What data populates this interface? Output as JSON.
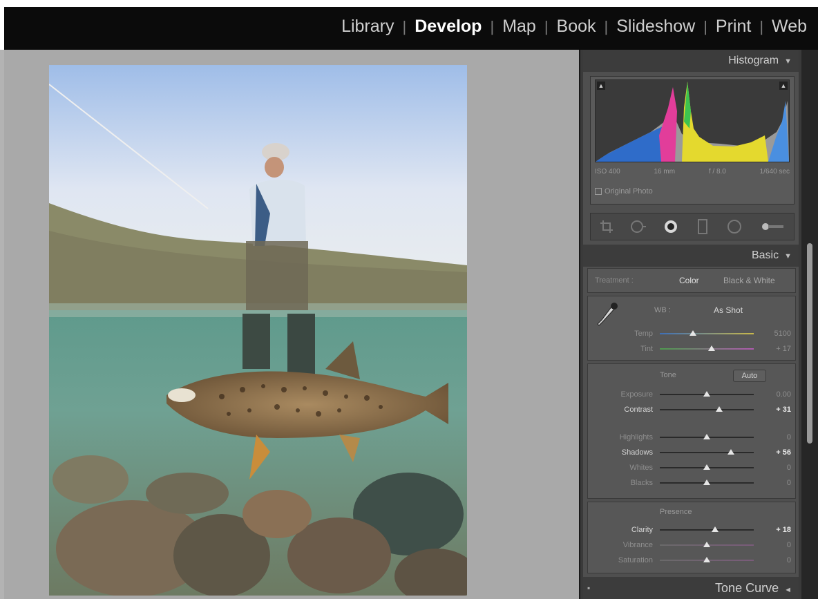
{
  "modules": [
    "Library",
    "Develop",
    "Map",
    "Book",
    "Slideshow",
    "Print",
    "Web"
  ],
  "active_module": "Develop",
  "histogram": {
    "title": "Histogram",
    "info": [
      "ISO 400",
      "16 mm",
      "f / 8.0",
      "1/640 sec"
    ],
    "original_photo": "Original Photo"
  },
  "tools": [
    "crop-overlay-icon",
    "spot-removal-icon",
    "red-eye-icon",
    "graduated-filter-icon",
    "radial-filter-icon",
    "adjustment-brush-icon"
  ],
  "basic": {
    "title": "Basic",
    "treatment_label": "Treatment :",
    "color": "Color",
    "bw": "Black & White",
    "wb_label": "WB :",
    "wb_value": "As Shot",
    "temp": {
      "label": "Temp",
      "value": "5100",
      "level": 0.35
    },
    "tint": {
      "label": "Tint",
      "value": "+ 17",
      "level": 0.55
    },
    "tone_label": "Tone",
    "auto": "Auto",
    "exposure": {
      "label": "Exposure",
      "value": "0.00",
      "level": 0.5
    },
    "contrast": {
      "label": "Contrast",
      "value": "+ 31",
      "level": 0.63
    },
    "highlights": {
      "label": "Highlights",
      "value": "0",
      "level": 0.5
    },
    "shadows": {
      "label": "Shadows",
      "value": "+ 56",
      "level": 0.76
    },
    "whites": {
      "label": "Whites",
      "value": "0",
      "level": 0.5
    },
    "blacks": {
      "label": "Blacks",
      "value": "0",
      "level": 0.5
    },
    "presence_label": "Presence",
    "clarity": {
      "label": "Clarity",
      "value": "+ 18",
      "level": 0.59
    },
    "vibrance": {
      "label": "Vibrance",
      "value": "0",
      "level": 0.5
    },
    "saturation": {
      "label": "Saturation",
      "value": "0",
      "level": 0.5
    }
  },
  "tone_curve": {
    "title": "Tone Curve"
  }
}
